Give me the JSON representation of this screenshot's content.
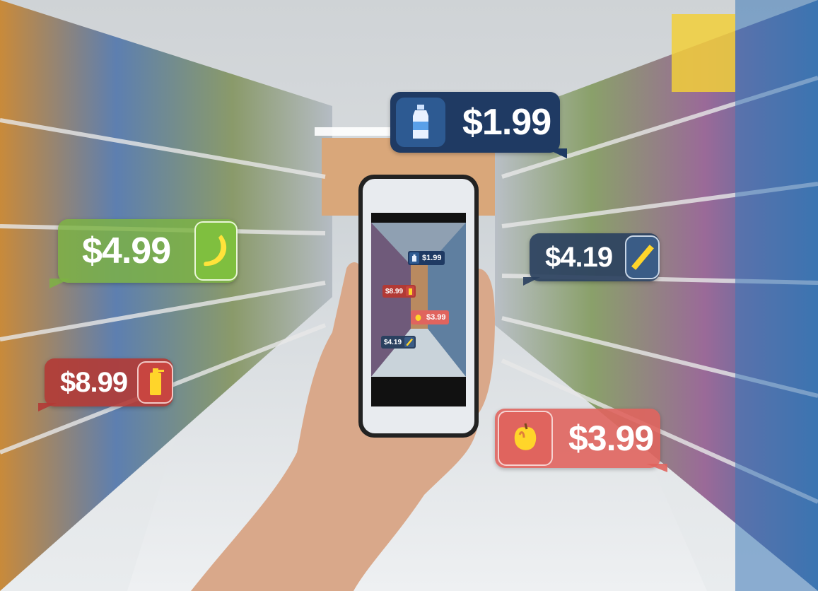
{
  "ar_tags": {
    "bottle": {
      "price": "$1.99",
      "icon": "water-bottle-icon"
    },
    "banana": {
      "price": "$4.99",
      "icon": "banana-icon"
    },
    "bar": {
      "price": "$4.19",
      "icon": "snack-bar-icon"
    },
    "drink": {
      "price": "$8.99",
      "icon": "drink-can-icon"
    },
    "fruit": {
      "price": "$3.99",
      "icon": "pear-icon"
    }
  },
  "phone_tags": {
    "bottle": {
      "price": "$1.99"
    },
    "drink": {
      "price": "$8.99"
    },
    "fruit": {
      "price": "$3.99"
    },
    "bar": {
      "price": "$4.19"
    }
  },
  "colors": {
    "bottle_tag": "#1f3a63",
    "banana_tag": "#7cb342",
    "bar_tag": "#2b4160",
    "drink_tag": "#b23a35",
    "fruit_tag": "#e0645e"
  }
}
